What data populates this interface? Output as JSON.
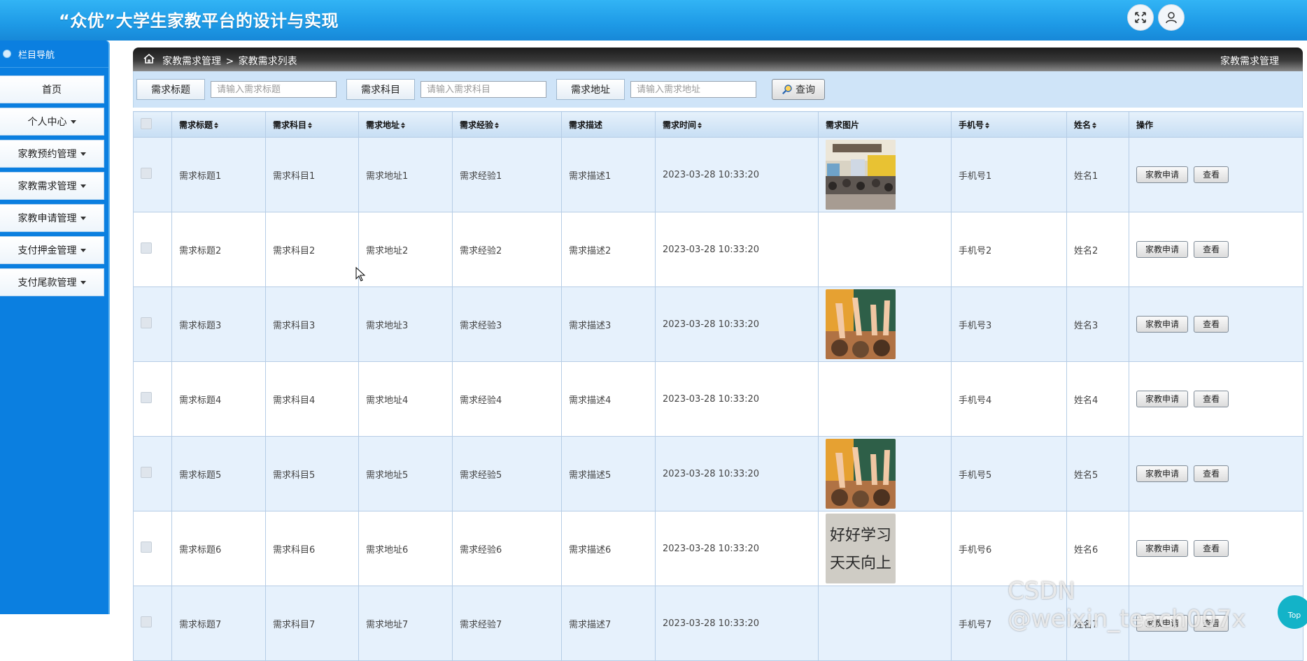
{
  "header": {
    "title": "“众优”大学生家教平台的设计与实现",
    "icons": [
      "fullscreen-icon",
      "user-icon"
    ]
  },
  "sidebar": {
    "head": "栏目导航",
    "items": [
      {
        "label": "首页",
        "caret": false
      },
      {
        "label": "个人中心",
        "caret": true
      },
      {
        "label": "家教预约管理",
        "caret": true
      },
      {
        "label": "家教需求管理",
        "caret": true
      },
      {
        "label": "家教申请管理",
        "caret": true
      },
      {
        "label": "支付押金管理",
        "caret": true
      },
      {
        "label": "支付尾款管理",
        "caret": true
      }
    ]
  },
  "breadcrumb": {
    "parent": "家教需求管理",
    "sep": ">",
    "current": "家教需求列表",
    "right": "家教需求管理"
  },
  "search": {
    "title_label": "需求标题",
    "title_placeholder": "请输入需求标题",
    "subject_label": "需求科目",
    "subject_placeholder": "请输入需求科目",
    "address_label": "需求地址",
    "address_placeholder": "请输入需求地址",
    "query_label": "查询"
  },
  "table": {
    "headers": [
      "需求标题",
      "需求科目",
      "需求地址",
      "需求经验",
      "需求描述",
      "需求时间",
      "需求图片",
      "手机号",
      "姓名",
      "操作"
    ],
    "actions": {
      "apply": "家教申请",
      "view": "查看"
    },
    "rows": [
      {
        "title": "需求标题1",
        "subject": "需求科目1",
        "address": "需求地址1",
        "experience": "需求经验1",
        "desc": "需求描述1",
        "time": "2023-03-28 10:33:20",
        "image": "classroom-lecture",
        "phone": "手机号1",
        "name": "姓名1"
      },
      {
        "title": "需求标题2",
        "subject": "需求科目2",
        "address": "需求地址2",
        "experience": "需求经验2",
        "desc": "需求描述2",
        "time": "2023-03-28 10:33:20",
        "image": "",
        "phone": "手机号2",
        "name": "姓名2"
      },
      {
        "title": "需求标题3",
        "subject": "需求科目3",
        "address": "需求地址3",
        "experience": "需求经验3",
        "desc": "需求描述3",
        "time": "2023-03-28 10:33:20",
        "image": "raised-hands",
        "phone": "手机号3",
        "name": "姓名3"
      },
      {
        "title": "需求标题4",
        "subject": "需求科目4",
        "address": "需求地址4",
        "experience": "需求经验4",
        "desc": "需求描述4",
        "time": "2023-03-28 10:33:20",
        "image": "",
        "phone": "手机号4",
        "name": "姓名4"
      },
      {
        "title": "需求标题5",
        "subject": "需求科目5",
        "address": "需求地址5",
        "experience": "需求经验5",
        "desc": "需求描述5",
        "time": "2023-03-28 10:33:20",
        "image": "raised-hands",
        "phone": "手机号5",
        "name": "姓名5"
      },
      {
        "title": "需求标题6",
        "subject": "需求科目6",
        "address": "需求地址6",
        "experience": "需求经验6",
        "desc": "需求描述6",
        "time": "2023-03-28 10:33:20",
        "image": "handwriting",
        "phone": "手机号6",
        "name": "姓名6"
      },
      {
        "title": "需求标题7",
        "subject": "需求科目7",
        "address": "需求地址7",
        "experience": "需求经验7",
        "desc": "需求描述7",
        "time": "2023-03-28 10:33:20",
        "image": "",
        "phone": "手机号7",
        "name": "姓名7"
      }
    ]
  },
  "watermark": "CSDN @weixin_teach007x",
  "top_button": "Top",
  "handwriting_lines": [
    "好好学习",
    "天天向上"
  ],
  "colors": {
    "header": "#1e9ae6",
    "sidebar": "#0b7fe0",
    "row_alt": "#e6f1fc",
    "top_button": "#13b3c8"
  }
}
